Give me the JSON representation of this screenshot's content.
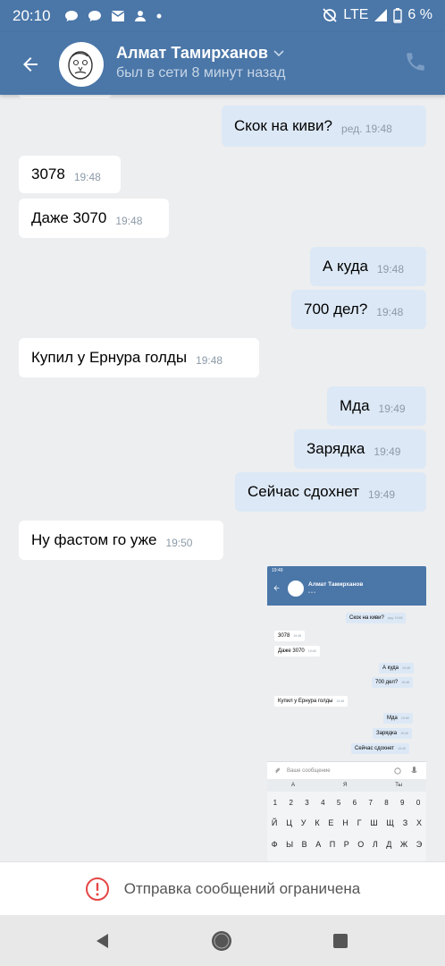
{
  "status_bar": {
    "time": "20:10",
    "network": "LTE",
    "battery": "6 %"
  },
  "header": {
    "contact_name": "Алмат Тамирханов",
    "contact_status": "был в сети 8 минут назад"
  },
  "messages": [
    {
      "dir": "out",
      "text": "Скок на киви?",
      "time": "ред. 19:48"
    },
    {
      "dir": "in",
      "text": "3078",
      "time": "19:48"
    },
    {
      "dir": "in",
      "text": "Даже 3070",
      "time": "19:48"
    },
    {
      "dir": "out",
      "text": "А куда",
      "time": "19:48"
    },
    {
      "dir": "out",
      "text": "700 дел?",
      "time": "19:48"
    },
    {
      "dir": "in",
      "text": "Купил у Ернура голды",
      "time": "19:48"
    },
    {
      "dir": "out",
      "text": "Мда",
      "time": "19:49"
    },
    {
      "dir": "out",
      "text": "Зарядка",
      "time": "19:49"
    },
    {
      "dir": "out",
      "text": "Сейчас сдохнет",
      "time": "19:49"
    },
    {
      "dir": "in",
      "text": "Ну фастом го уже",
      "time": "19:50"
    }
  ],
  "attachment": {
    "status_time": "19:49",
    "contact_name": "Алмат Тамирханов",
    "messages": [
      {
        "dir": "out",
        "text": "Скок на киви?",
        "time": "ред. 19:48"
      },
      {
        "dir": "in",
        "text": "3078",
        "time": "19:48"
      },
      {
        "dir": "in",
        "text": "Даже 3070",
        "time": "19:48"
      },
      {
        "dir": "out",
        "text": "А куда",
        "time": "19:48"
      },
      {
        "dir": "out",
        "text": "700 дел?",
        "time": "19:48"
      },
      {
        "dir": "in",
        "text": "Купил у Ернура голды",
        "time": "19:48"
      },
      {
        "dir": "out",
        "text": "Мда",
        "time": "19:49"
      },
      {
        "dir": "out",
        "text": "Зарядка",
        "time": "19:49"
      },
      {
        "dir": "out",
        "text": "Сейчас сдохнет",
        "time": "19:49"
      }
    ],
    "input_placeholder": "Ваше сообщение",
    "keyboard_suggestions": [
      "А",
      "Я",
      "Ты"
    ],
    "keyboard_numbers": [
      "1",
      "2",
      "3",
      "4",
      "5",
      "6",
      "7",
      "8",
      "9",
      "0"
    ],
    "keyboard_row1": [
      "Й",
      "Ц",
      "У",
      "К",
      "Е",
      "Н",
      "Г",
      "Ш",
      "Щ",
      "З",
      "Х"
    ],
    "keyboard_row2": [
      "Ф",
      "Ы",
      "В",
      "А",
      "П",
      "Р",
      "О",
      "Л",
      "Д",
      "Ж",
      "Э"
    ]
  },
  "restriction": {
    "text": "Отправка сообщений ограничена"
  },
  "colors": {
    "header": "#4a76a8",
    "outgoing": "#dce8f5",
    "incoming": "#ffffff",
    "background": "#edeef0",
    "warning": "#e64646"
  }
}
